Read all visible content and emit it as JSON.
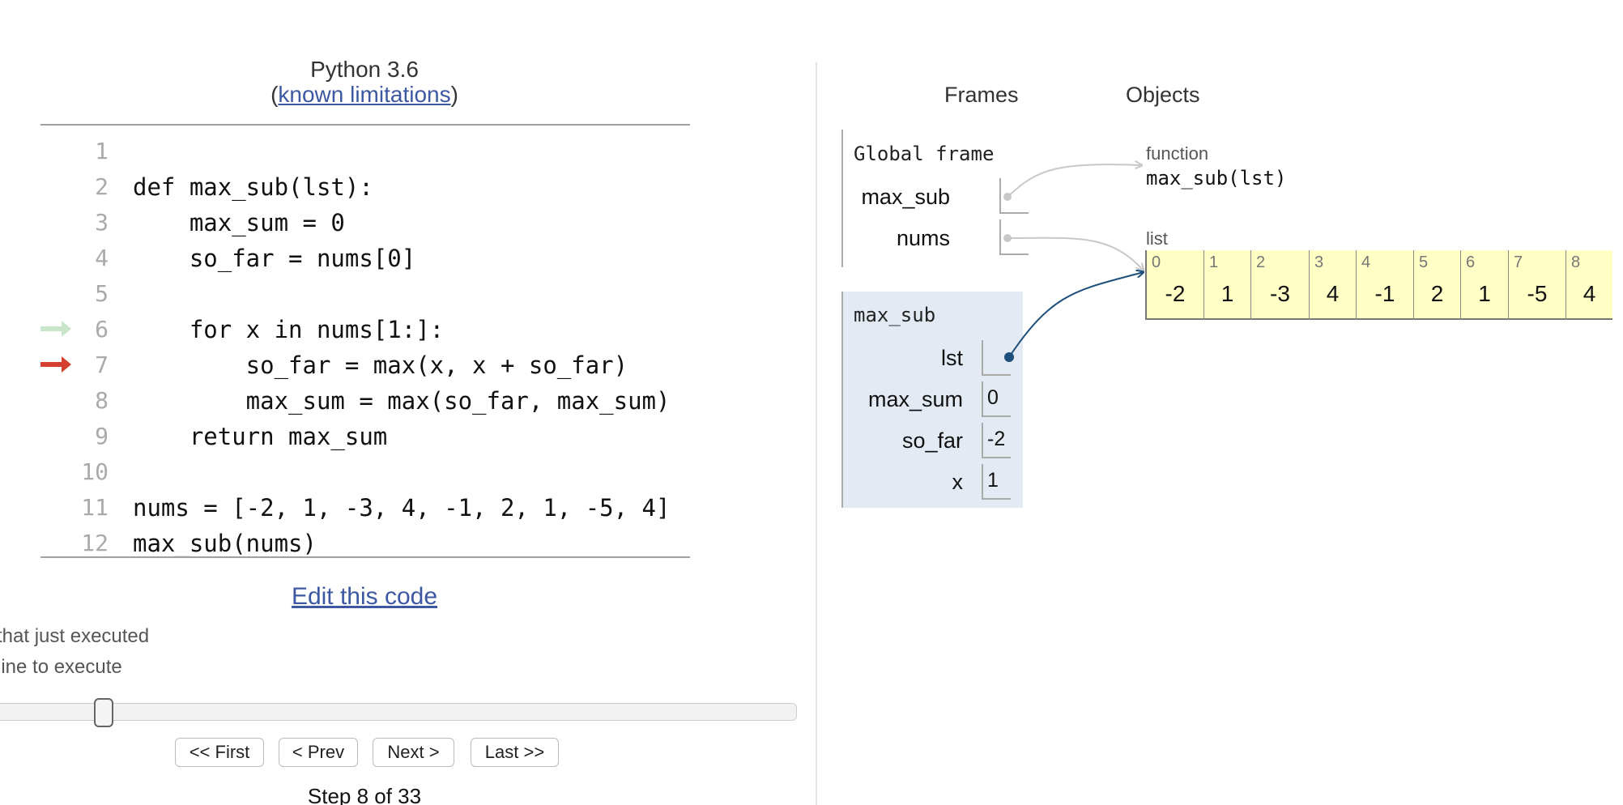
{
  "header": {
    "language": "Python 3.6",
    "paren_open": "(",
    "limitations_link": "known limitations",
    "paren_close": ")"
  },
  "code": {
    "lines": [
      {
        "num": "1",
        "text": ""
      },
      {
        "num": "2",
        "text": "def max_sub(lst):"
      },
      {
        "num": "3",
        "text": "    max_sum = 0"
      },
      {
        "num": "4",
        "text": "    so_far = nums[0]"
      },
      {
        "num": "5",
        "text": ""
      },
      {
        "num": "6",
        "text": "    for x in nums[1:]:"
      },
      {
        "num": "7",
        "text": "        so_far = max(x, x + so_far)"
      },
      {
        "num": "8",
        "text": "        max_sum = max(so_far, max_sum)"
      },
      {
        "num": "9",
        "text": "    return max_sum"
      },
      {
        "num": "10",
        "text": ""
      },
      {
        "num": "11",
        "text": "nums = [-2, 1, -3, 4, -1, 2, 1, -5, 4]"
      },
      {
        "num": "12",
        "text": "max_sub(nums)"
      }
    ],
    "just_executed_line": 6,
    "next_line": 7,
    "just_executed_color": "#c9e6ca",
    "next_color": "#d43f2f"
  },
  "edit_link": "Edit this code",
  "legend": {
    "executed": "that just executed",
    "next": "line to execute"
  },
  "slider": {
    "step": 8,
    "total": 33
  },
  "nav": {
    "first": "<< First",
    "prev": "< Prev",
    "next": "Next >",
    "last": "Last >>"
  },
  "step_label": "Step 8 of 33",
  "viz": {
    "frames_heading": "Frames",
    "objects_heading": "Objects",
    "global_frame": {
      "title": "Global frame",
      "vars": [
        {
          "name": "max_sub",
          "kind": "pointer"
        },
        {
          "name": "nums",
          "kind": "pointer"
        }
      ]
    },
    "func_frame": {
      "title": "max_sub",
      "vars": [
        {
          "name": "lst",
          "value": ""
        },
        {
          "name": "max_sum",
          "value": "0"
        },
        {
          "name": "so_far",
          "value": "-2"
        },
        {
          "name": "x",
          "value": "1"
        }
      ]
    },
    "function_obj": {
      "type": "function",
      "signature": "max_sub(lst)"
    },
    "list_obj": {
      "type": "list",
      "items": [
        {
          "index": "0",
          "value": "-2"
        },
        {
          "index": "1",
          "value": "1"
        },
        {
          "index": "2",
          "value": "-3"
        },
        {
          "index": "3",
          "value": "4"
        },
        {
          "index": "4",
          "value": "-1"
        },
        {
          "index": "5",
          "value": "2"
        },
        {
          "index": "6",
          "value": "1"
        },
        {
          "index": "7",
          "value": "-5"
        },
        {
          "index": "8",
          "value": "4"
        }
      ]
    },
    "colors": {
      "frame_bg": "#e3eaf4",
      "list_bg": "#ffffc6",
      "active_pointer": "#1d4f7c",
      "inactive_pointer": "#c8c8c8",
      "link": "#3D58A2"
    }
  }
}
